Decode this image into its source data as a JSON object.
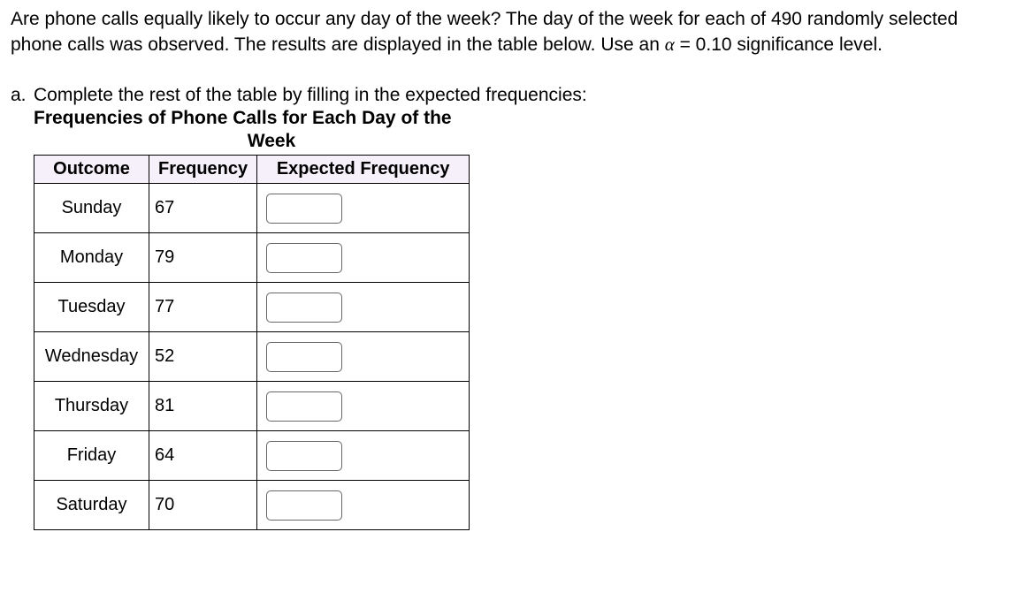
{
  "intro": {
    "text_before_alpha": "Are phone calls equally likely to occur any day of the week? The day of the week for each of 490 randomly selected phone calls was observed. The results are displayed in the table below.  Use an ",
    "alpha_symbol": "α",
    "text_after_alpha": " = 0.10 significance level."
  },
  "part_a": {
    "marker": "a.",
    "instruction": "Complete the rest of the table by filling in the expected frequencies:",
    "table_title_line1": "Frequencies of Phone Calls for Each Day of the",
    "table_title_line2": "Week"
  },
  "table": {
    "headers": {
      "outcome": "Outcome",
      "frequency": "Frequency",
      "expected": "Expected Frequency"
    },
    "rows": [
      {
        "outcome": "Sunday",
        "frequency": "67",
        "expected": ""
      },
      {
        "outcome": "Monday",
        "frequency": "79",
        "expected": ""
      },
      {
        "outcome": "Tuesday",
        "frequency": "77",
        "expected": ""
      },
      {
        "outcome": "Wednesday",
        "frequency": "52",
        "expected": ""
      },
      {
        "outcome": "Thursday",
        "frequency": "81",
        "expected": ""
      },
      {
        "outcome": "Friday",
        "frequency": "64",
        "expected": ""
      },
      {
        "outcome": "Saturday",
        "frequency": "70",
        "expected": ""
      }
    ]
  }
}
